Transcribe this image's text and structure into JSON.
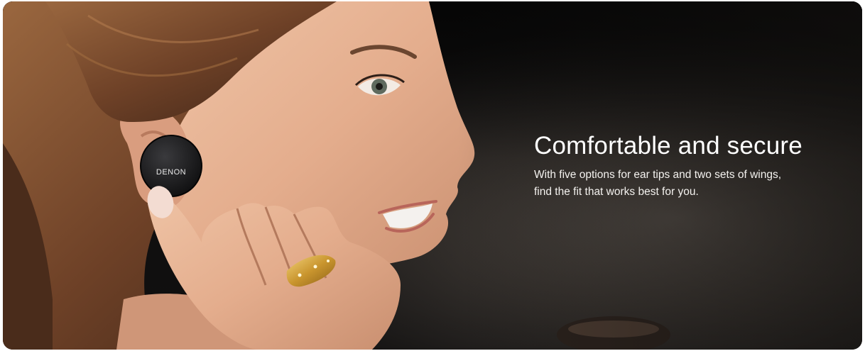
{
  "hero": {
    "headline": "Comfortable and secure",
    "body_lines": [
      "With five options for ear tips and two sets of wings,",
      "find the fit that works best for you."
    ],
    "earbud_logo": "DENON",
    "image_icon": "woman-wearing-earbud-photo"
  },
  "colors": {
    "background_dark": "#141210",
    "text": "#ffffff",
    "skin": "#e6b395",
    "hair": "#7a4a2c",
    "earbud": "#1c1c1e"
  }
}
